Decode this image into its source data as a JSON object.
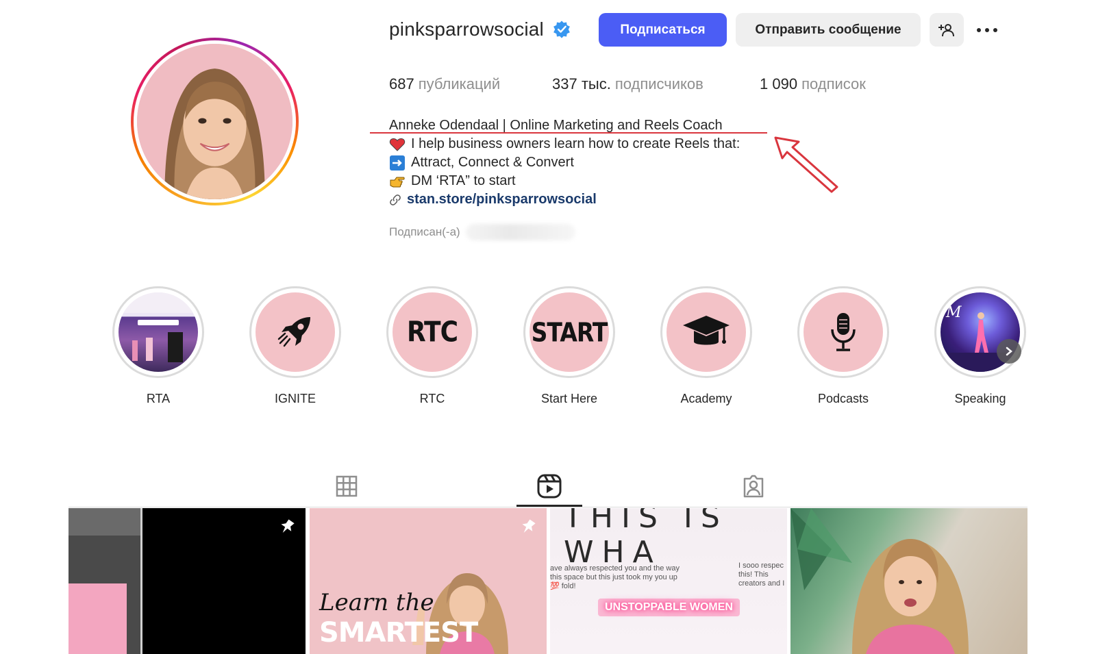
{
  "profile": {
    "username": "pinksparrowsocial",
    "verified_icon": "verified-badge-icon",
    "follow_label": "Подписаться",
    "message_label": "Отправить сообщение",
    "stats": {
      "posts_count": "687",
      "posts_label": "публикаций",
      "followers_count": "337 тыс.",
      "followers_label": "подписчиков",
      "following_count": "1 090",
      "following_label": "подписок"
    },
    "bio": {
      "name": "Anneke Odendaal | Online Marketing and Reels Coach",
      "line1": "I help business owners learn how to create Reels that:",
      "line2": "Attract, Connect & Convert",
      "line3": "DM ‘RTA” to start",
      "link": "stan.store/pinksparrowsocial"
    },
    "followed_by_label": "Подписан(-а)"
  },
  "highlights": [
    {
      "label": "RTA",
      "cover": "photo"
    },
    {
      "label": "IGNITE",
      "cover": "rocket-icon"
    },
    {
      "label": "RTC",
      "cover_text": "RTC"
    },
    {
      "label": "Start Here",
      "cover_text": "START"
    },
    {
      "label": "Academy",
      "cover": "graduation-cap-icon"
    },
    {
      "label": "Podcasts",
      "cover": "microphone-icon"
    },
    {
      "label": "Speaking",
      "cover": "photo"
    }
  ],
  "tabs": [
    {
      "name": "posts",
      "icon": "grid-icon"
    },
    {
      "name": "reels",
      "icon": "reels-icon",
      "active": true
    },
    {
      "name": "tagged",
      "icon": "tagged-icon"
    }
  ],
  "reels": {
    "tile2_script": "Learn the",
    "tile2_bold": "SMARTEST",
    "tile3_heading": "THIS IS WHA",
    "tile3_chat": "ave always respected you and the way this space but this just took my you up 💯 fold!",
    "tile3_chat2": "I sooo respec this! This creators and I",
    "tile3_glow": "UNSTOPPABLE WOMEN"
  },
  "colors": {
    "follow_button": "#4b5df5",
    "secondary_button": "#efefef",
    "annotation_red": "#d9363e",
    "highlight_pink": "#f3c2c7"
  }
}
